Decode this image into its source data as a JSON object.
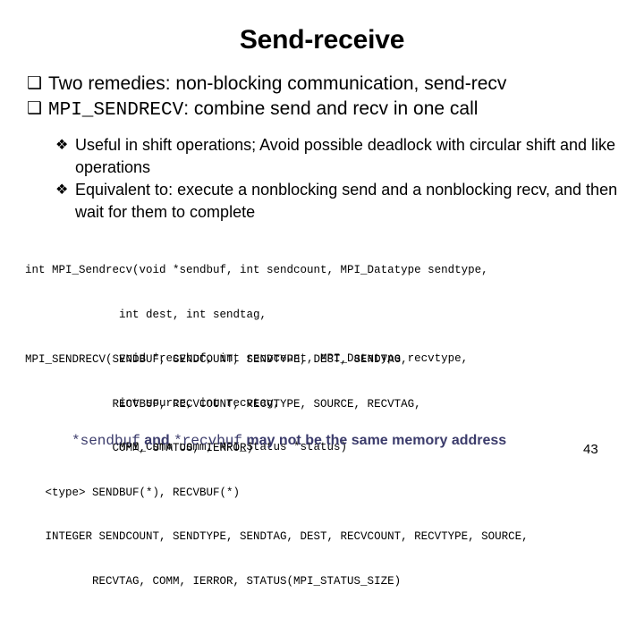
{
  "slide": {
    "title": "Send-receive",
    "page_number": "43",
    "accent_color": "#3b3b6b",
    "text_color": "#000000",
    "background_color": "#ffffff"
  },
  "bullets": [
    {
      "level": 1,
      "marker": "❑",
      "marker_name": "hollow-square-bullet",
      "text": "Two remedies: non-blocking communication, send-recv",
      "mono_prefix": ""
    },
    {
      "level": 1,
      "marker": "❑",
      "marker_name": "hollow-square-bullet",
      "mono_prefix": "MPI_SENDRECV",
      "text": ": combine send and recv in one call"
    },
    {
      "level": 2,
      "marker": "❖",
      "marker_name": "diamond-bullet",
      "text": "Useful in shift operations; Avoid possible deadlock with circular shift and like operations"
    },
    {
      "level": 2,
      "marker": "❖",
      "marker_name": "diamond-bullet",
      "text": "Equivalent to: execute a nonblocking send and a nonblocking recv, and then wait for them to complete"
    }
  ],
  "c_signature": {
    "language": "C",
    "lines": [
      "int MPI_Sendrecv(void *sendbuf, int sendcount, MPI_Datatype sendtype,",
      "              int dest, int sendtag,",
      "              void *recvbuf, int recvcount, MPI_Datatype recvtype,",
      "              int source, int recvtag,",
      "              MPI_Comm comm, MPI_Status *status)"
    ]
  },
  "fortran_signature": {
    "language": "Fortran",
    "lines": [
      "MPI_SENDRECV(SENDBUF, SENDCOUNT, SENDTYPE, DEST, SENDTAG,",
      "             RECVBUF, RECVCOUNT, RECVTYPE, SOURCE, RECVTAG,",
      "             COMM, STATUS, IERROR)",
      "   <type> SENDBUF(*), RECVBUF(*)",
      "   INTEGER SENDCOUNT, SENDTYPE, SENDTAG, DEST, RECVCOUNT, RECVTYPE, SOURCE,",
      "          RECVTAG, COMM, IERROR, STATUS(MPI_STATUS_SIZE)"
    ]
  },
  "note": {
    "part1_mono": "*sendbuf",
    "part2": " and ",
    "part3_mono": "*recvbuf",
    "part4": " may not be the same memory address"
  }
}
